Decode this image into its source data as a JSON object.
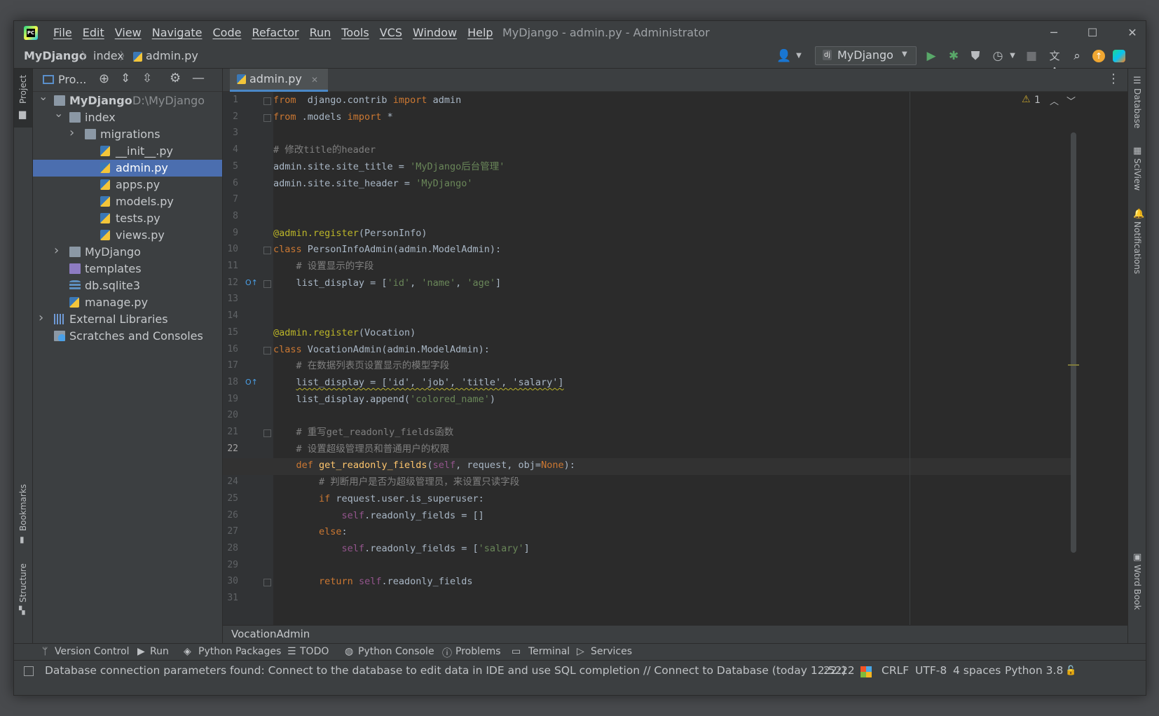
{
  "title_bar": {
    "logo_text": "PC",
    "menu": [
      "File",
      "Edit",
      "View",
      "Navigate",
      "Code",
      "Refactor",
      "Run",
      "Tools",
      "VCS",
      "Window",
      "Help"
    ],
    "window_title": "MyDjango - admin.py - Administrator",
    "controls": [
      "─",
      "☐",
      "✕"
    ]
  },
  "nav": {
    "crumbs": [
      "MyDjango",
      "index",
      "admin.py"
    ],
    "run_config": "MyDjango",
    "icons": [
      "user-icon",
      "run-icon",
      "debug-icon",
      "coverage-icon",
      "profile-icon",
      "stop-icon",
      "translate-icon",
      "search-icon",
      "update-icon",
      "jetbrains-icon"
    ]
  },
  "left_strip": {
    "project": "Project",
    "bookmarks": "Bookmarks",
    "structure": "Structure"
  },
  "right_strip": {
    "database": "Database",
    "sciview": "SciView",
    "notifications": "Notifications",
    "wordbook": "Word Book"
  },
  "project_panel": {
    "title": "Pro...",
    "tree": [
      {
        "label": "MyDjango",
        "path": "D:\\MyDjango",
        "icon": "folder",
        "depth": 0,
        "arrow": "▼"
      },
      {
        "label": "index",
        "icon": "folder",
        "depth": 1,
        "arrow": "▼"
      },
      {
        "label": "migrations",
        "icon": "folder",
        "depth": 2,
        "arrow": "▶"
      },
      {
        "label": "__init__.py",
        "icon": "py",
        "depth": 3,
        "arrow": ""
      },
      {
        "label": "admin.py",
        "icon": "py",
        "depth": 3,
        "arrow": "",
        "selected": true
      },
      {
        "label": "apps.py",
        "icon": "py",
        "depth": 3,
        "arrow": ""
      },
      {
        "label": "models.py",
        "icon": "py",
        "depth": 3,
        "arrow": ""
      },
      {
        "label": "tests.py",
        "icon": "py",
        "depth": 3,
        "arrow": ""
      },
      {
        "label": "views.py",
        "icon": "py",
        "depth": 3,
        "arrow": ""
      },
      {
        "label": "MyDjango",
        "icon": "folder",
        "depth": 1,
        "arrow": "▶"
      },
      {
        "label": "templates",
        "icon": "folder-purple",
        "depth": 1,
        "arrow": ""
      },
      {
        "label": "db.sqlite3",
        "icon": "db",
        "depth": 1,
        "arrow": ""
      },
      {
        "label": "manage.py",
        "icon": "py",
        "depth": 1,
        "arrow": ""
      },
      {
        "label": "External Libraries",
        "icon": "lib",
        "depth": 0,
        "arrow": "▶"
      },
      {
        "label": "Scratches and Consoles",
        "icon": "scratch",
        "depth": 0,
        "arrow": ""
      }
    ]
  },
  "editor": {
    "tab": "admin.py",
    "warning_count": "1",
    "current_line": 22,
    "breadcrumb": "VocationAdmin",
    "lines": [
      [
        [
          "kw",
          "from"
        ],
        [
          "",
          "  django.contrib "
        ],
        [
          "kw",
          "import"
        ],
        [
          "",
          "",
          " admin"
        ]
      ],
      [
        [
          "kw",
          "from"
        ],
        [
          "",
          " .models "
        ],
        [
          "kw",
          "import"
        ],
        [
          "",
          " *"
        ]
      ],
      [],
      [
        [
          "cm",
          "# 修改title的header"
        ]
      ],
      [
        [
          "",
          "admin.site.site_title = "
        ],
        [
          "str",
          "'MyDjango后台管理'"
        ]
      ],
      [
        [
          "",
          "admin.site.site_header = "
        ],
        [
          "str",
          "'MyDjango'"
        ]
      ],
      [],
      [],
      [
        [
          "dec",
          "@admin.register"
        ],
        [
          "",
          "(PersonInfo)"
        ]
      ],
      [
        [
          "kw",
          "class"
        ],
        [
          "",
          " PersonInfoAdmin(admin.ModelAdmin):"
        ]
      ],
      [
        [
          "",
          "    "
        ],
        [
          "cm",
          "# 设置显示的字段"
        ]
      ],
      [
        [
          "",
          "    list_display = ["
        ],
        [
          "str",
          "'id'"
        ],
        [
          "",
          ", "
        ],
        [
          "str",
          "'name'"
        ],
        [
          "",
          ", "
        ],
        [
          "str",
          "'age'"
        ],
        [
          "",
          "]"
        ]
      ],
      [],
      [],
      [
        [
          "dec",
          "@admin.register"
        ],
        [
          "",
          "(Vocation)"
        ]
      ],
      [
        [
          "kw",
          "class"
        ],
        [
          "",
          " VocationAdmin(admin.ModelAdmin):"
        ]
      ],
      [
        [
          "",
          "    "
        ],
        [
          "cm",
          "# 在数据列表页设置显示的模型字段"
        ]
      ],
      [
        [
          "",
          "    "
        ],
        [
          "squig",
          "list_display = ['id', 'job', 'title', 'salary']"
        ]
      ],
      [
        [
          "",
          "    list_display.append("
        ],
        [
          "str",
          "'colored_name'"
        ],
        [
          "",
          ")"
        ]
      ],
      [],
      [
        [
          "",
          "    "
        ],
        [
          "cm",
          "# 重写get_readonly_fields函数"
        ]
      ],
      [
        [
          "",
          "    "
        ],
        [
          "cm",
          "# 设置超级管理员和普通用户的权限"
        ]
      ],
      [
        [
          "",
          "    "
        ],
        [
          "kw",
          "def"
        ],
        [
          "",
          " "
        ],
        [
          "fn",
          "get_readonly_fields"
        ],
        [
          "",
          "("
        ],
        [
          "selfc",
          "self"
        ],
        [
          "",
          ", request, obj="
        ],
        [
          "kw",
          "None"
        ],
        [
          "",
          "):"
        ]
      ],
      [
        [
          "",
          "        "
        ],
        [
          "cm",
          "# 判断用户是否为超级管理员，来设置只读字段"
        ]
      ],
      [
        [
          "",
          "        "
        ],
        [
          "kw",
          "if"
        ],
        [
          "",
          " request.user.is_superuser:"
        ]
      ],
      [
        [
          "",
          "            "
        ],
        [
          "selfc",
          "self"
        ],
        [
          "",
          ".readonly_fields = []"
        ]
      ],
      [
        [
          "",
          "        "
        ],
        [
          "kw",
          "else"
        ],
        [
          "",
          ":"
        ]
      ],
      [
        [
          "",
          "            "
        ],
        [
          "selfc",
          "self"
        ],
        [
          "",
          ".readonly_fields = ["
        ],
        [
          "str",
          "'salary'"
        ],
        [
          "",
          "]"
        ]
      ],
      [],
      [
        [
          "",
          "        "
        ],
        [
          "kw",
          "return"
        ],
        [
          "",
          " "
        ],
        [
          "selfc",
          "self"
        ],
        [
          "",
          ".readonly_fields"
        ]
      ],
      []
    ]
  },
  "tool_windows": [
    "Version Control",
    "Run",
    "Python Packages",
    "TODO",
    "Python Console",
    "Problems",
    "Terminal",
    "Services"
  ],
  "status": {
    "message": "Database connection parameters found: Connect to the database to edit data in IDE and use SQL completion // Connect to Database (today 12:52)",
    "position": "22:22",
    "line_sep": "CRLF",
    "encoding": "UTF-8",
    "indent": "4 spaces",
    "interpreter": "Python 3.8"
  },
  "colors": {
    "accent": "#4b6eaf",
    "tab_underline": "#4a88c7",
    "editor_bg": "#2b2b2b",
    "keyword": "#cc7832",
    "string": "#6a8759",
    "comment": "#808080"
  }
}
